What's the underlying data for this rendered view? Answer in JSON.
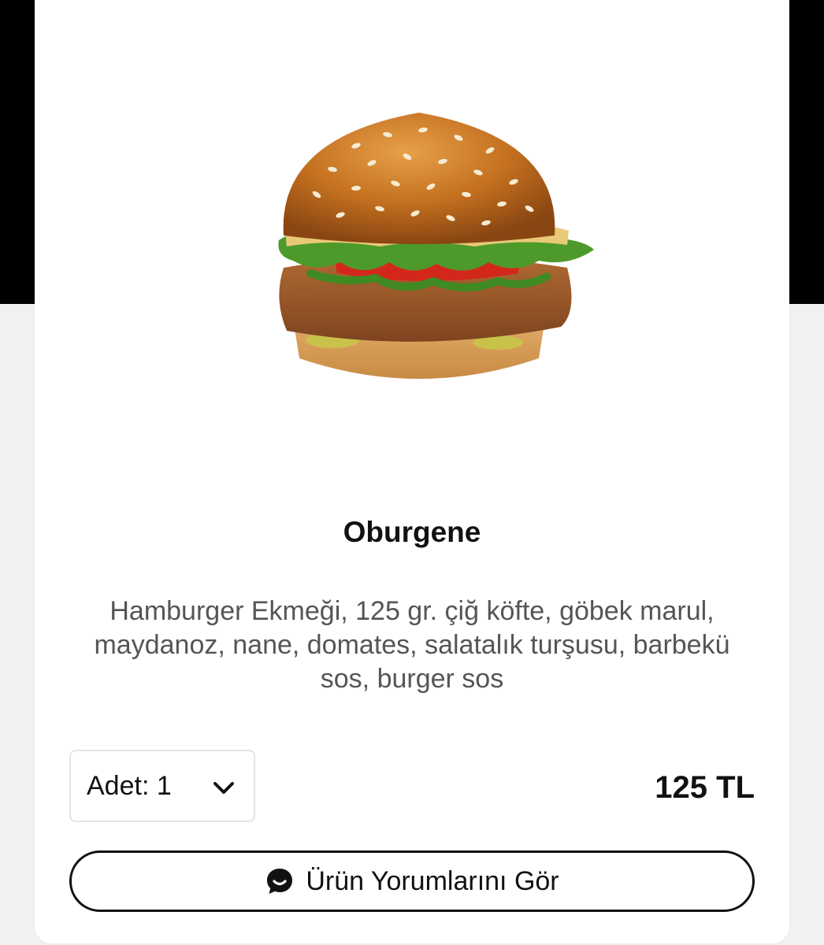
{
  "colors": {
    "header_band": "#000000",
    "page_background": "#f1f1f1",
    "card_background": "#ffffff",
    "text_primary": "#111111",
    "text_secondary": "#555555"
  },
  "product": {
    "image_icon": "burger-image",
    "name": "Oburgene",
    "description": "Hamburger Ekmeği, 125 gr. çiğ köfte, göbek marul, maydanoz, nane, domates, salatalık turşusu, barbekü sos, burger sos",
    "quantity_label": "Adet: 1",
    "quantity_icon": "chevron-down-icon",
    "price": "125 TL"
  },
  "reviews_button": {
    "label": "Ürün Yorumlarını Gör",
    "icon": "chat-bubble-icon"
  }
}
